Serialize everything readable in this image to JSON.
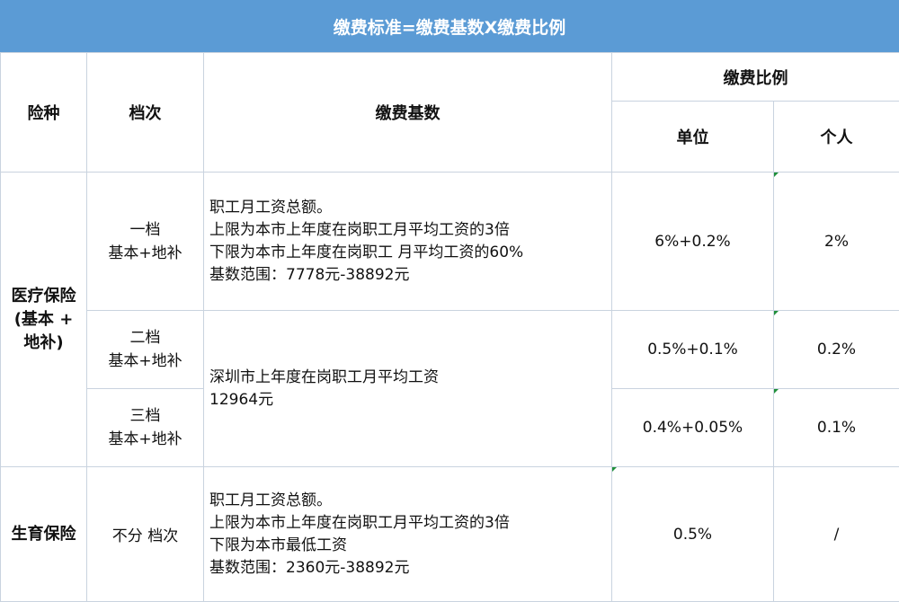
{
  "title": "缴费标准=缴费基数X缴费比例",
  "headers": {
    "type": "险种",
    "tier": "档次",
    "base": "缴费基数",
    "ratio": "缴费比例",
    "employer": "单位",
    "individual": "个人"
  },
  "medical": {
    "name_lines": [
      "医疗保险",
      "(基本 +",
      "地补)"
    ],
    "tier1": {
      "tier_lines": [
        "一档",
        "基本+地补"
      ],
      "base_lines": [
        "职工月工资总额。",
        "上限为本市上年度在岗职工月平均工资的3倍",
        "下限为本市上年度在岗职工 月平均工资的60%",
        "基数范围：7778元-38892元"
      ],
      "employer": "6%+0.2%",
      "individual": "2%"
    },
    "tier2": {
      "tier_lines": [
        "二档",
        "基本+地补"
      ],
      "employer": "0.5%+0.1%",
      "individual": "0.2%"
    },
    "tier3": {
      "tier_lines": [
        "三档",
        "基本+地补"
      ],
      "employer": "0.4%+0.05%",
      "individual": "0.1%"
    },
    "shared_base_lines": [
      "深圳市上年度在岗职工月平均工资",
      "12964元"
    ]
  },
  "maternity": {
    "name": "生育保险",
    "tier": "不分 档次",
    "base_lines": [
      "职工月工资总额。",
      "上限为本市上年度在岗职工月平均工资的3倍",
      "下限为本市最低工资",
      "基数范围：2360元-38892元"
    ],
    "employer": "0.5%",
    "individual": "/"
  }
}
